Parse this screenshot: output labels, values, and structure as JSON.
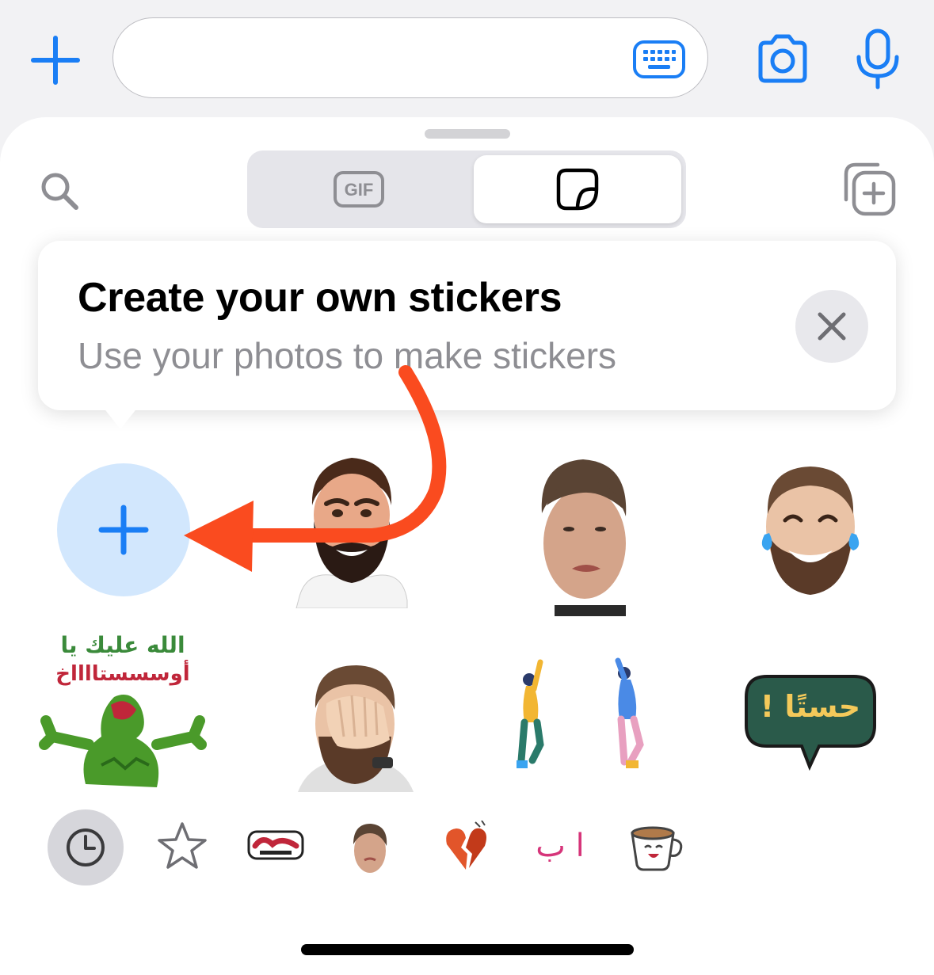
{
  "input_bar": {
    "message_placeholder": ""
  },
  "segments": {
    "gif_label": "GIF",
    "selected": "stickers"
  },
  "tip": {
    "title": "Create your own stickers",
    "subtitle": "Use your photos to make stickers"
  },
  "stickers": {
    "speech_bubble_text": "حستًا !",
    "kermit_text_line1": "الله عليك يا",
    "kermit_text_line2": "أوسسستااااخ"
  },
  "category_tabs": {
    "arabic_pack_label": "ا ب",
    "selected": "recent"
  },
  "colors": {
    "accent": "#1a7ef5",
    "arrow": "#fa4b1f",
    "create_bg": "#d2e7fd",
    "secondary_text": "#8e8e93"
  },
  "icons": [
    "plus-icon",
    "keyboard-icon",
    "camera-icon",
    "microphone-icon",
    "search-icon",
    "gif-icon",
    "sticker-icon",
    "add-sticker-pack-icon",
    "close-icon",
    "clock-icon",
    "star-icon"
  ]
}
